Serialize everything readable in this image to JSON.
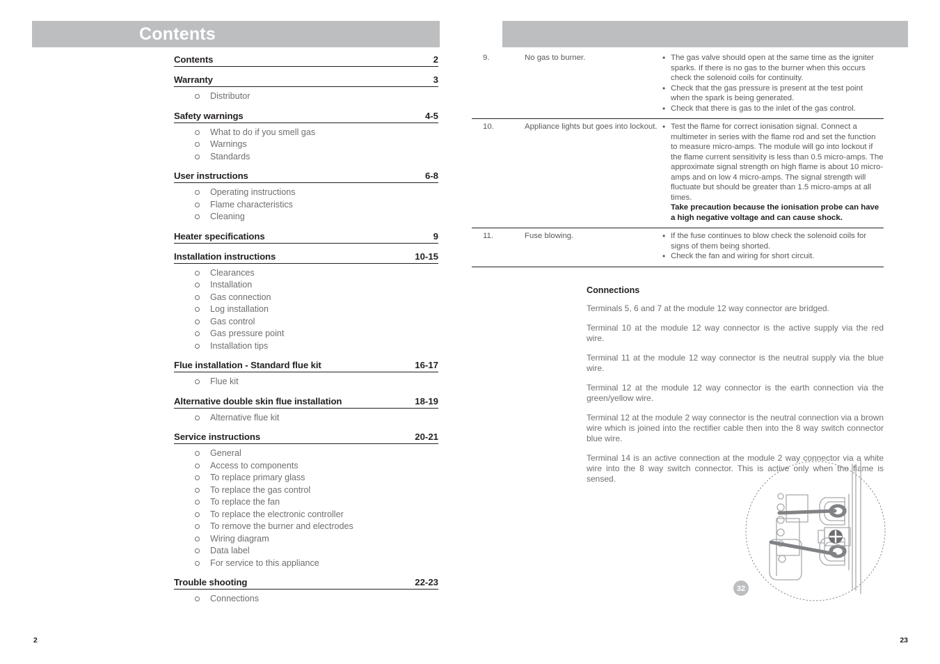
{
  "left_page": {
    "header_title": "Contents",
    "folio": "2",
    "toc": [
      {
        "title": "Contents",
        "pages": "2",
        "subitems": []
      },
      {
        "title": "Warranty",
        "pages": "3",
        "subitems": [
          "Distributor"
        ]
      },
      {
        "title": "Safety warnings",
        "pages": "4-5",
        "subitems": [
          "What to do if you smell gas",
          "Warnings",
          "Standards"
        ]
      },
      {
        "title": "User instructions",
        "pages": "6-8",
        "subitems": [
          "Operating instructions",
          "Flame characteristics",
          "Cleaning"
        ]
      },
      {
        "title": "Heater specifications",
        "pages": "9",
        "subitems": []
      },
      {
        "title": "Installation instructions",
        "pages": "10-15",
        "subitems": [
          "Clearances",
          "Installation",
          "Gas connection",
          "Log installation",
          "Gas control",
          "Gas pressure point",
          "Installation tips"
        ]
      },
      {
        "title": "Flue installation - Standard flue kit",
        "pages": "16-17",
        "subitems": [
          "Flue kit"
        ]
      },
      {
        "title": "Alternative double skin flue installation",
        "pages": "18-19",
        "subitems": [
          "Alternative flue kit"
        ]
      },
      {
        "title": "Service instructions",
        "pages": "20-21",
        "subitems": [
          "General",
          "Access to components",
          "To replace primary glass",
          "To replace the gas control",
          "To replace the fan",
          "To replace the electronic controller",
          "To remove the burner and electrodes",
          "Wiring diagram",
          "Data label",
          "For service to this appliance"
        ]
      },
      {
        "title": "Trouble shooting",
        "pages": "22-23",
        "subitems": [
          "Connections"
        ]
      }
    ]
  },
  "right_page": {
    "header_title": "",
    "folio": "23",
    "troubleshooting_rows": [
      {
        "number": "9.",
        "fault": "No gas to burner.",
        "actions": [
          {
            "text": "The gas valve should open at the same time as the igniter sparks. If there is no gas to the burner when this occurs check the solenoid coils for continuity.",
            "bold": false
          },
          {
            "text": "Check that the gas pressure is present at the test point when the spark is being generated.",
            "bold": false
          },
          {
            "text": "Check that there is gas to the inlet of the gas control.",
            "bold": false
          }
        ]
      },
      {
        "number": "10.",
        "fault": "Appliance lights but goes into lockout.",
        "actions": [
          {
            "text": "Test the flame for correct ionisation signal. Connect a multimeter in series with the flame rod and set the function to measure micro-amps. The module will go into lockout if the flame current sensitivity is less than 0.5 micro-amps. The approximate signal strength on high flame is about 10 micro-amps and on low 4  micro-amps. The signal strength will fluctuate but should be greater than 1.5 micro-amps at all times.",
            "bold": false
          },
          {
            "text": "Take precaution because the ionisation probe can have a high negative voltage and can cause shock.",
            "bold": true
          }
        ]
      },
      {
        "number": "11.",
        "fault": "Fuse blowing.",
        "actions": [
          {
            "text": "If the fuse continues to blow check the solenoid coils for signs of them being shorted.",
            "bold": false
          },
          {
            "text": "Check the fan and wiring for short circuit.",
            "bold": false
          }
        ]
      }
    ],
    "connections": {
      "heading": "Connections",
      "paragraphs": [
        "Terminals 5, 6 and 7 at the module 12 way connector are bridged.",
        "Terminal 10 at the module 12 way connector is the active supply via the red wire.",
        "Terminal 11 at the module 12 way connector is the neutral supply via the blue wire.",
        "Terminal 12 at the module 12 way connector is the earth connection via the green/yellow wire.",
        "Terminal 12 at the module 2 way connector is the neutral connection via a brown wire which is joined into the rectifier cable then into the 8 way switch connector blue wire.",
        "Terminal 14 is an active connection at the module 2 way connector via a white wire into the 8 way switch connector. This is active only when the flame is sensed."
      ]
    },
    "figure": {
      "badge_label": "32"
    }
  },
  "colors": {
    "header_bar": "#bcbec0",
    "header_text": "#ffffff",
    "body_text": "#58595b",
    "heading_text": "#231f20",
    "rule": "#231f20",
    "badge": "#bcbec0"
  }
}
